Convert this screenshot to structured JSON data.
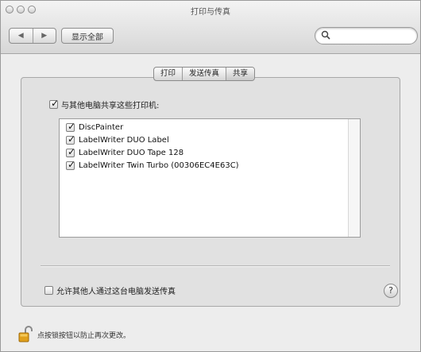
{
  "window": {
    "title": "打印与传真"
  },
  "toolbar": {
    "back_label": "◀",
    "forward_label": "▶",
    "show_all_label": "显示全部",
    "search_value": "",
    "search_placeholder": ""
  },
  "tabs": [
    {
      "label": "打印",
      "active": false
    },
    {
      "label": "发送传真",
      "active": false
    },
    {
      "label": "共享",
      "active": true
    }
  ],
  "share_printers": {
    "label": "与其他电脑共享这些打印机:",
    "checked": true
  },
  "printers": [
    {
      "name": "DiscPainter",
      "checked": true
    },
    {
      "name": "LabelWriter DUO Label",
      "checked": true
    },
    {
      "name": "LabelWriter DUO Tape 128",
      "checked": true
    },
    {
      "name": "LabelWriter Twin Turbo (00306EC4E63C)",
      "checked": true
    }
  ],
  "allow_fax": {
    "label": "允许其他人通过这台电脑发送传真",
    "checked": false
  },
  "help_label": "?",
  "lock": {
    "text": "点按锁按钮以防止再次更改。"
  },
  "check_mark": "✓"
}
